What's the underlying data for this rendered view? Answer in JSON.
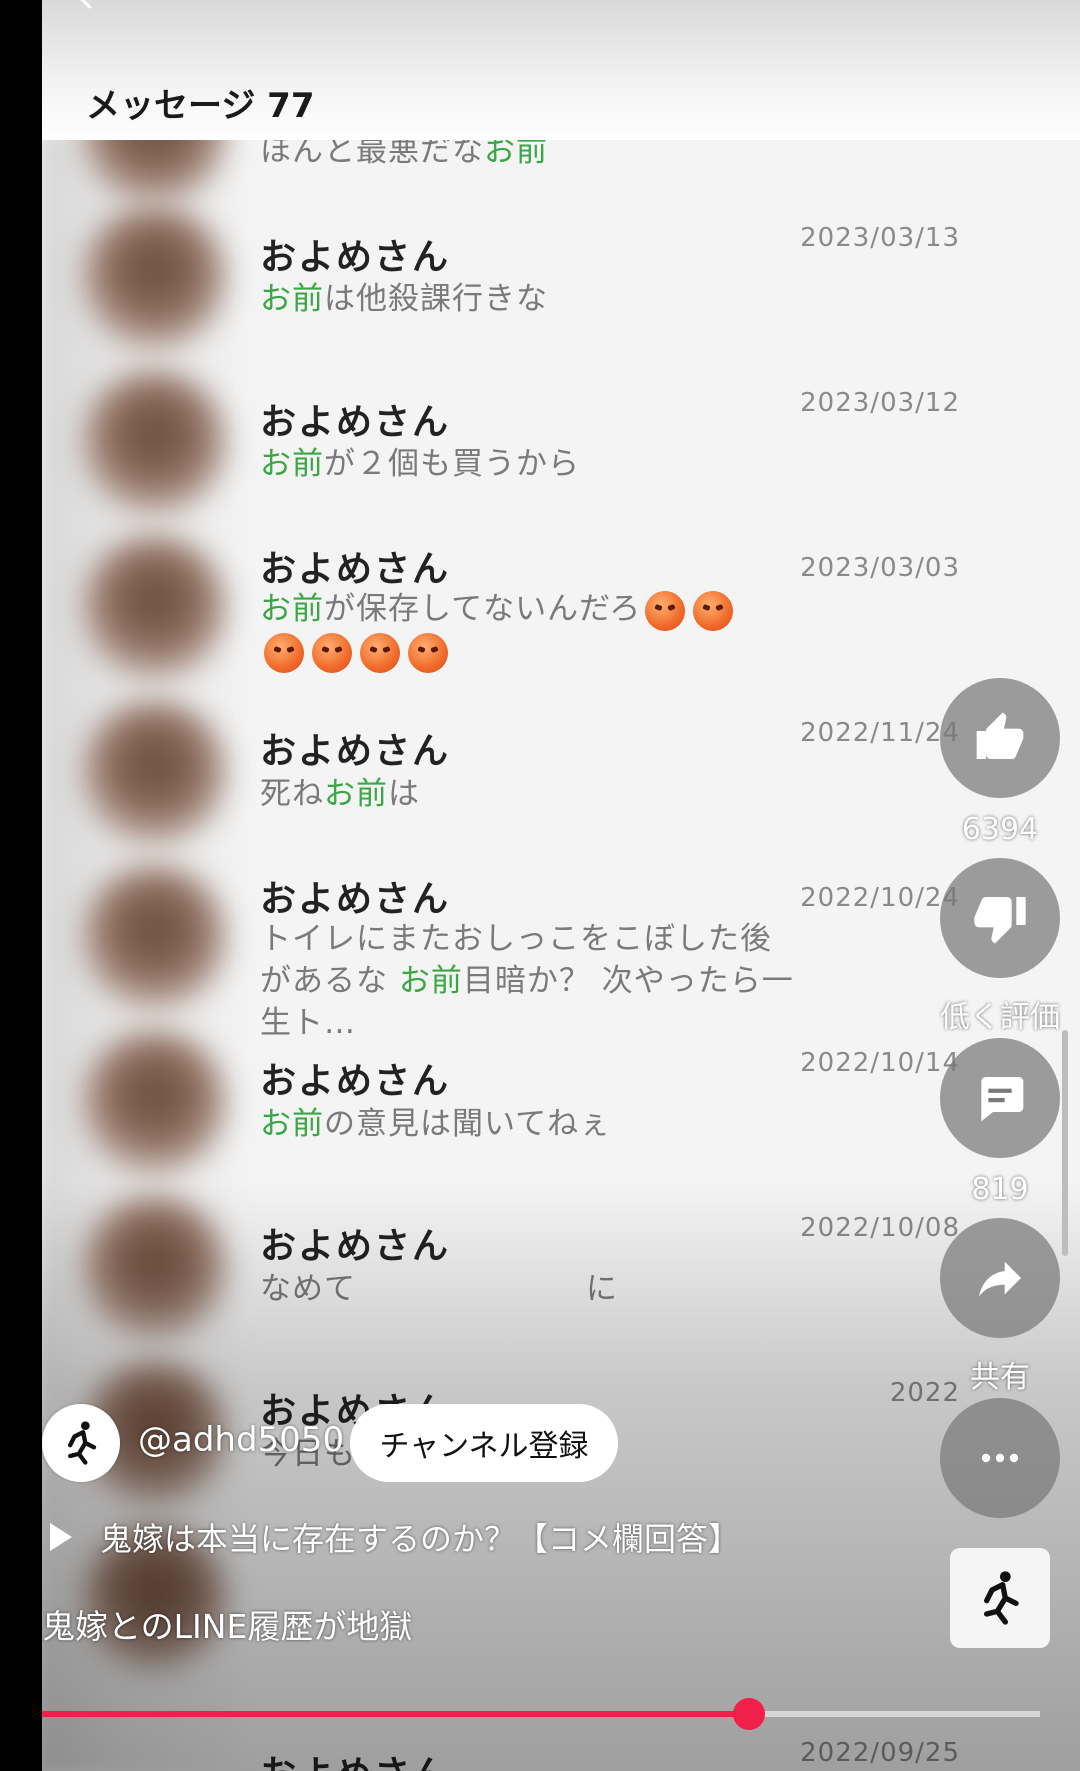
{
  "header": {
    "title": "メッセージ 77"
  },
  "messages": [
    {
      "sender": "",
      "parts": [
        {
          "t": "ほんと最悪だな"
        },
        {
          "t": "お前",
          "k": true
        }
      ],
      "date": ""
    },
    {
      "sender": "およめさん",
      "parts": [
        {
          "t": "お前",
          "k": true
        },
        {
          "t": "は他殺課行きな"
        }
      ],
      "date": "2023/03/13"
    },
    {
      "sender": "およめさん",
      "parts": [
        {
          "t": "お前",
          "k": true
        },
        {
          "t": "が２個も買うから"
        }
      ],
      "date": "2023/03/12"
    },
    {
      "sender": "およめさん",
      "parts": [
        {
          "t": "お前",
          "k": true
        },
        {
          "t": "が保存してないんだろ"
        }
      ],
      "date": "2023/03/03"
    },
    {
      "sender": "およめさん",
      "parts": [
        {
          "t": "死ね"
        },
        {
          "t": "お前",
          "k": true
        },
        {
          "t": "は"
        }
      ],
      "date": "2022/11/24"
    },
    {
      "sender": "およめさん",
      "parts": [
        {
          "t": "トイレにまたおしっこをこぼした後があるな "
        },
        {
          "t": "お前",
          "k": true
        },
        {
          "t": "目暗か？ 次やったら一生ト…"
        }
      ],
      "date": "2022/10/24"
    },
    {
      "sender": "およめさん",
      "parts": [
        {
          "t": "お前",
          "k": true
        },
        {
          "t": "の意見は聞いてねぇ"
        }
      ],
      "date": "2022/10/14"
    },
    {
      "sender": "およめさん",
      "parts": [
        {
          "t": "なめて"
        },
        {
          "t": "に"
        }
      ],
      "date": "2022/10/08"
    },
    {
      "sender": "およめさん",
      "parts": [
        {
          "t": "今日もおせぇなぁ"
        },
        {
          "t": "お前",
          "k": true
        },
        {
          "t": "は"
        }
      ],
      "date": "2022"
    },
    {
      "sender": "およめさん",
      "parts": [],
      "date": "2022/09/25"
    }
  ],
  "actions": {
    "like": {
      "count": "6394",
      "icon": "thumbs-up-icon"
    },
    "dislike": {
      "label": "低く評価",
      "icon": "thumbs-down-icon"
    },
    "comments": {
      "count": "819",
      "icon": "comment-icon"
    },
    "share": {
      "label": "共有",
      "icon": "share-icon"
    },
    "more": {
      "icon": "more-horizontal-icon"
    }
  },
  "channel": {
    "handle": "@adhd5050",
    "subscribe_label": "チャンネル登録",
    "icon": "running-person-icon"
  },
  "related": {
    "label": "鬼嫁は本当に存在するのか？【コメ欄回答】",
    "icon": "play-icon"
  },
  "video": {
    "title": "鬼嫁とのLINE履歴が地獄",
    "progress": 0.708
  },
  "colors": {
    "keyword": "#3aa644",
    "progress": "#f0204a"
  }
}
